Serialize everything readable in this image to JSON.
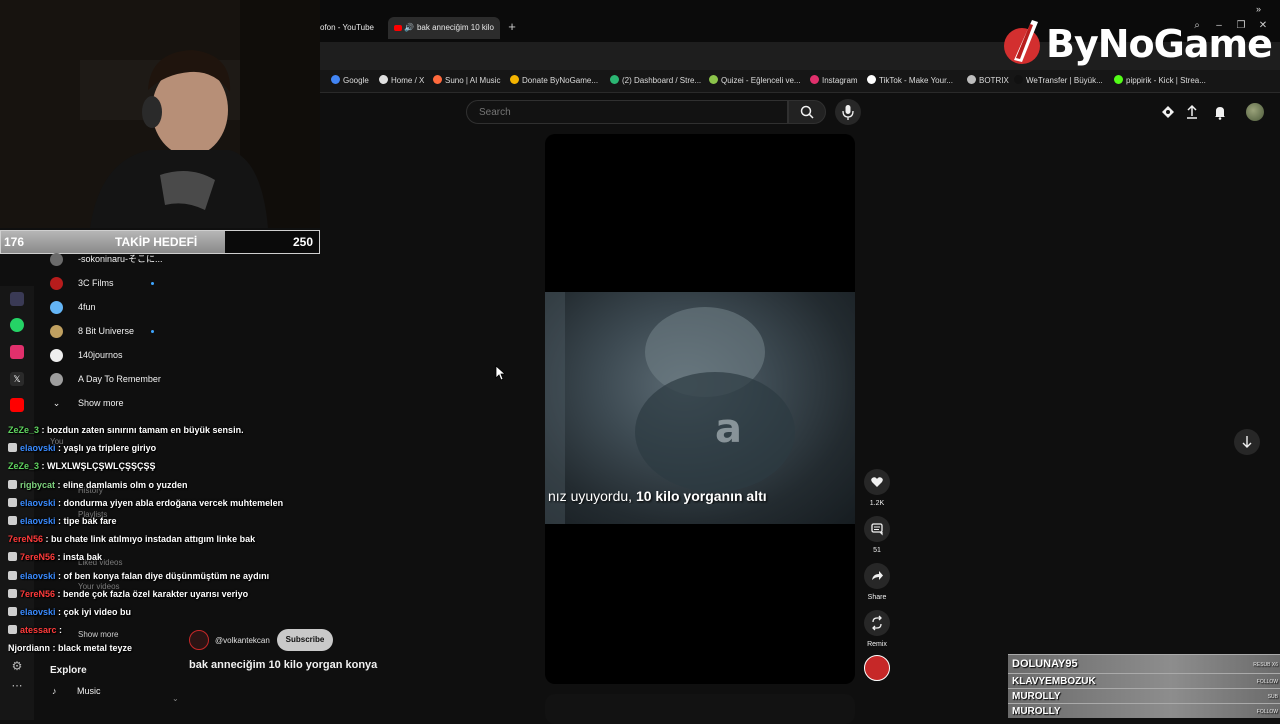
{
  "browser": {
    "tab_prev_label": "ofon - YouTube",
    "tab_active_label": "bak anneciğim 10 kilo",
    "bookmarks": [
      {
        "label": "Google",
        "color": "#4285f4"
      },
      {
        "label": "Home / X",
        "color": "#e0e0e0"
      },
      {
        "label": "Suno | AI Music",
        "color": "#ff6a3d"
      },
      {
        "label": "Donate ByNoGame...",
        "color": "#f4b400"
      },
      {
        "label": "(2) Dashboard / Stre...",
        "color": "#2bb673"
      },
      {
        "label": "Quizei - Eğlenceli ve...",
        "color": "#8bc34a"
      },
      {
        "label": "Instagram",
        "color": "#e1306c"
      },
      {
        "label": "TikTok - Make Your...",
        "color": "#ffffff"
      },
      {
        "label": "BOTRIX",
        "color": "#bdbdbd"
      },
      {
        "label": "WeTransfer | Büyük...",
        "color": "#111111"
      },
      {
        "label": "pippirik - Kick | Strea...",
        "color": "#53fc18"
      }
    ],
    "more_icon": "»"
  },
  "brand": {
    "name": "ByNoGame"
  },
  "youtube": {
    "search_placeholder": "Search",
    "sidebar": {
      "subscriptions": [
        {
          "name": "-sokoninaru-そこに...",
          "color": "#6b6b6b",
          "live": false
        },
        {
          "name": "3C Films",
          "color": "#b71c1c",
          "live": true
        },
        {
          "name": "4fun",
          "color": "#64b5f6",
          "live": false
        },
        {
          "name": "8 Bit Universe",
          "color": "#c0a060",
          "live": true
        },
        {
          "name": "140journos",
          "color": "#eeeeee",
          "live": false
        },
        {
          "name": "A Day To Remember",
          "color": "#9e9e9e",
          "live": false
        }
      ],
      "show_more_label": "Show more",
      "hidden_labels": {
        "you": "You",
        "history": "History",
        "playlists": "Playlists",
        "liked": "Liked videos",
        "your_videos": "Your videos",
        "show_more_2": "Show more"
      },
      "explore_label": "Explore",
      "music_label": "Music"
    },
    "short": {
      "caption_prefix": "nız uyuyordu, ",
      "caption_bold": "10 kilo yorganın altı",
      "channel_handle": "@volkantekcan",
      "subscribe_label": "Subscribe",
      "title": "bak anneciğim 10 kilo yorgan konya"
    },
    "actions": {
      "like_count": "1.2K",
      "comment_count": "51",
      "share_label": "Share",
      "remix_label": "Remix"
    }
  },
  "stream_overlay": {
    "goal": {
      "current": "176",
      "label": "TAKİP HEDEFİ",
      "target": "250",
      "progress": 0.704
    },
    "chat": [
      {
        "user": "ZeZe_3",
        "color": "#5fd35f",
        "msg": "bozdun zaten sınırını tamam en büyük sensin."
      },
      {
        "user": "elaovski",
        "color": "#3a8bff",
        "msg": "yaşlı ya triplere giriyo"
      },
      {
        "user": "ZeZe_3",
        "color": "#5fd35f",
        "msg": "WLXLWŞLÇŞWLÇŞŞÇŞŞ"
      },
      {
        "user": "rigbycat",
        "color": "#7fd37f",
        "msg": "eline damlamis olm o yuzden"
      },
      {
        "user": "elaovski",
        "color": "#3a8bff",
        "msg": "dondurma yiyen abla erdoğana vercek muhtemelen"
      },
      {
        "user": "elaovski",
        "color": "#3a8bff",
        "msg": "tipe bak fare"
      },
      {
        "user": "7ereN56",
        "color": "#ff3b3b",
        "msg": "bu chate link atılmıyo instadan attıgım linke bak"
      },
      {
        "user": "7ereN56",
        "color": "#ff3b3b",
        "msg": "insta bak"
      },
      {
        "user": "elaovski",
        "color": "#3a8bff",
        "msg": "of ben konya falan diye düşünmüştüm ne aydını"
      },
      {
        "user": "7ereN56",
        "color": "#ff3b3b",
        "msg": "bende çok fazla özel karakter uyarısı veriyo"
      },
      {
        "user": "elaovski",
        "color": "#3a8bff",
        "msg": "çok iyi video bu"
      },
      {
        "user": "atessarc",
        "color": "#ff3b3b",
        "msg": ""
      },
      {
        "user": "Njordiann",
        "color": "#ffffff",
        "msg": "black metal teyze"
      }
    ],
    "events": [
      {
        "name": "DOLUNAY95",
        "tag": "RESUB X6"
      },
      {
        "name": "KLAVYEMBOZUK",
        "tag": "FOLLOW"
      },
      {
        "name": "MUROLLY",
        "tag": "SUB"
      },
      {
        "name": "MUROLLY",
        "tag": "FOLLOW"
      }
    ]
  },
  "colors": {
    "accent_red": "#ff0000",
    "live_blue": "#3ea6ff"
  }
}
